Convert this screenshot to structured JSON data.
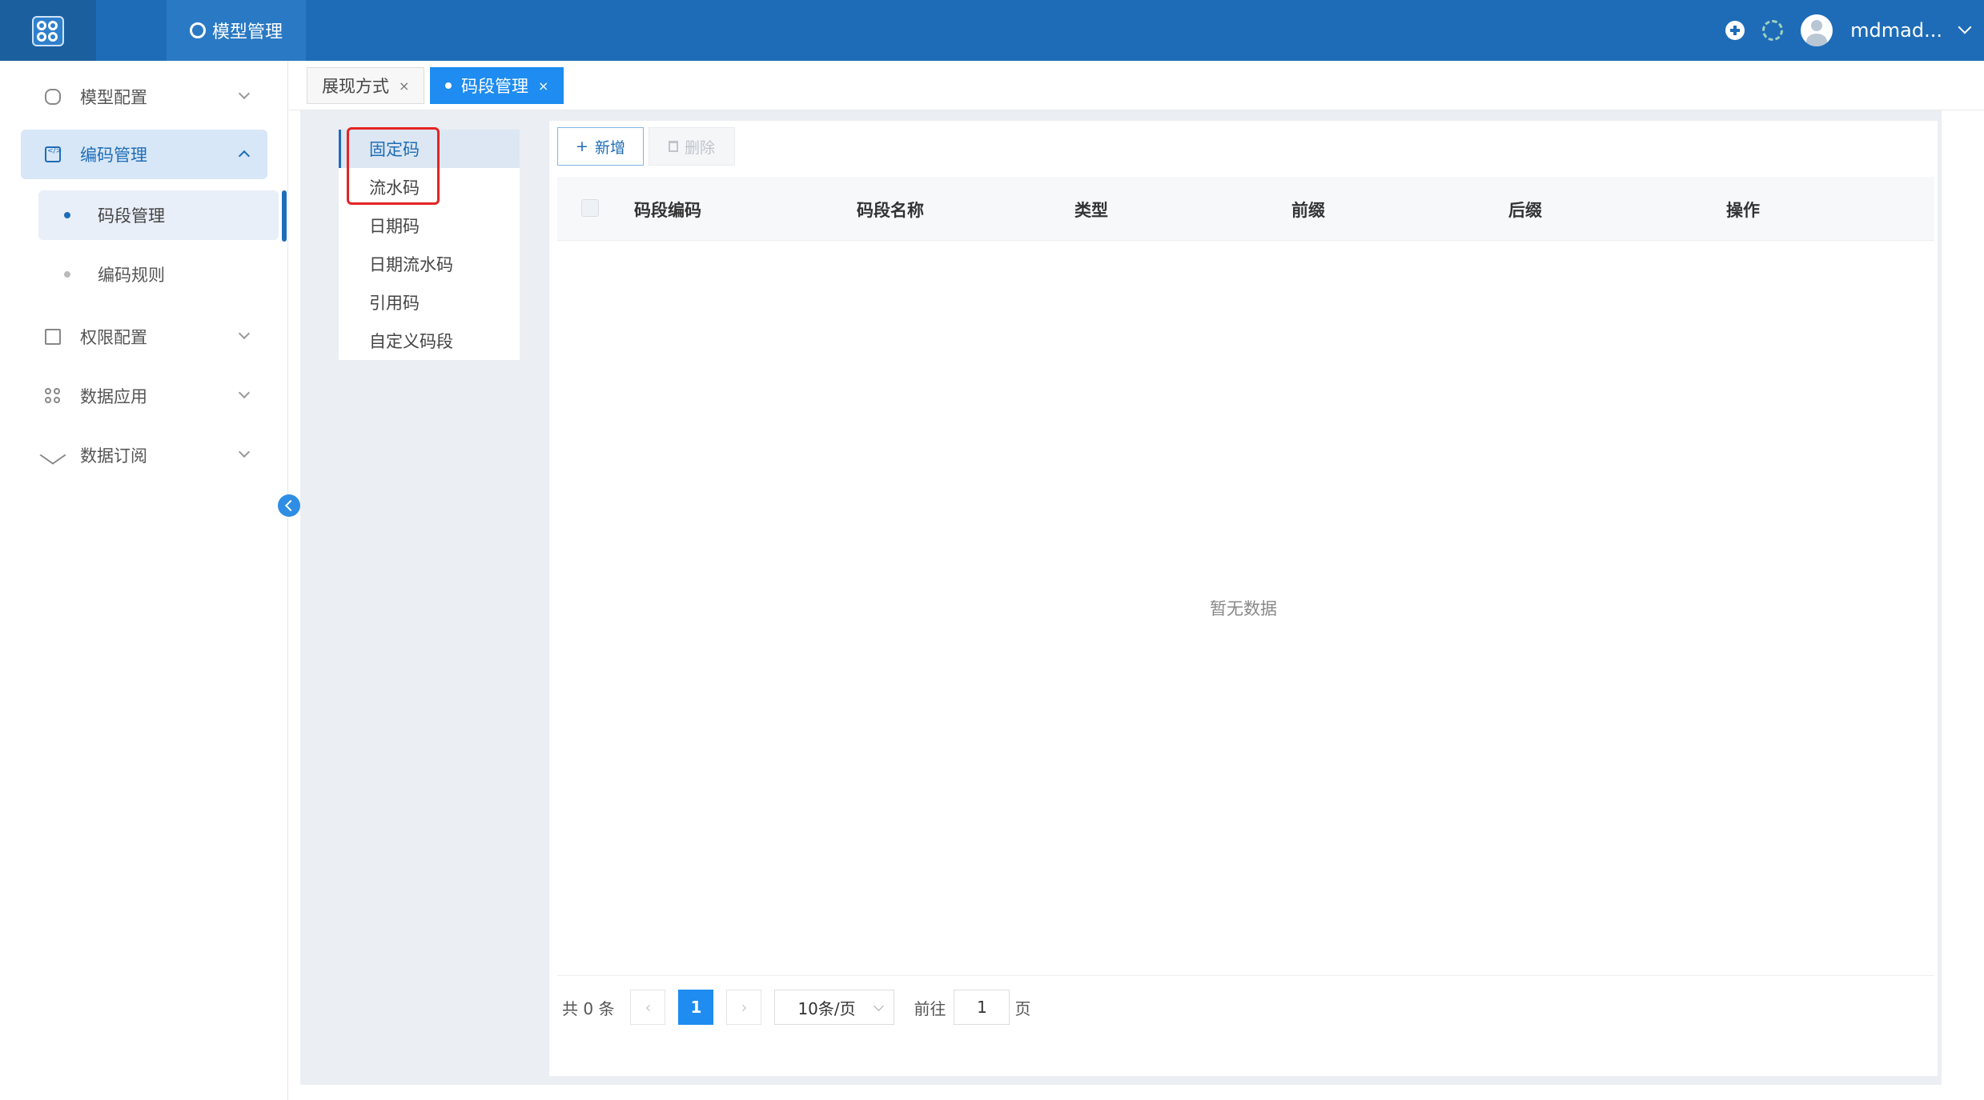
{
  "header": {
    "module_tab": "模型管理",
    "username": "mdmad..."
  },
  "sidebar": {
    "items": [
      {
        "label": "模型配置",
        "icon": "database-icon"
      },
      {
        "label": "编码管理",
        "icon": "code-icon",
        "active": true,
        "children": [
          {
            "label": "码段管理",
            "active": true
          },
          {
            "label": "编码规则"
          }
        ]
      },
      {
        "label": "权限配置",
        "icon": "permission-icon"
      },
      {
        "label": "数据应用",
        "icon": "apps-grid-icon"
      },
      {
        "label": "数据订阅",
        "icon": "send-icon"
      }
    ]
  },
  "tabs": [
    {
      "label": "展现方式",
      "close": "×"
    },
    {
      "label": "码段管理",
      "close": "×",
      "active": true
    }
  ],
  "segment_types": [
    "固定码",
    "流水码",
    "日期码",
    "日期流水码",
    "引用码",
    "自定义码段"
  ],
  "toolbar": {
    "add_label": "新增",
    "add_icon": "+",
    "delete_label": "删除"
  },
  "table": {
    "columns": [
      "码段编码",
      "码段名称",
      "类型",
      "前缀",
      "后缀",
      "操作"
    ],
    "empty_text": "暂无数据"
  },
  "pagination": {
    "total_text": "共 0 条",
    "prev": "‹",
    "next": "›",
    "current_page": "1",
    "page_size": "10条/页",
    "goto_label": "前往",
    "goto_value": "1",
    "page_unit": "页"
  },
  "colors": {
    "header_bg": "#1e6cb7",
    "accent": "#1e8cf0",
    "annotation_red": "#e52424"
  }
}
